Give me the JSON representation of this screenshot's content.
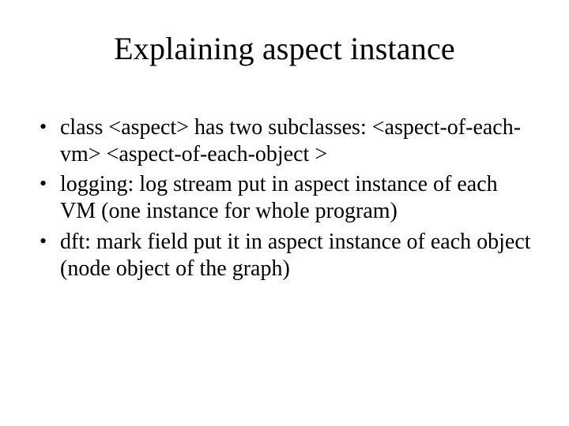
{
  "slide": {
    "title": "Explaining aspect instance",
    "bullets": [
      "class <aspect> has two subclasses: <aspect-of-each-vm> <aspect-of-each-object >",
      "logging: log stream put in aspect instance of each VM (one instance for whole program)",
      "dft: mark field put it in aspect instance of each object (node object of the graph)"
    ]
  }
}
